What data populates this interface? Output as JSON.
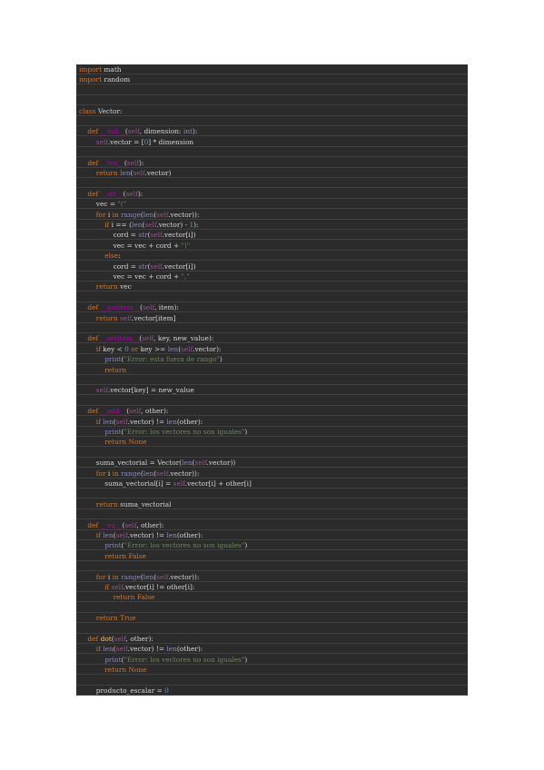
{
  "colors": {
    "page_background": "#ffffff",
    "editor_background": "#2b2b2b",
    "keyword": "#cc7832",
    "self": "#94558d",
    "function_name": "#ffc66d",
    "dunder": "#b200b2",
    "string": "#6a8759",
    "number": "#6897bb",
    "builtin": "#8888c6",
    "text": "#d4d4d4"
  },
  "code": {
    "lines": [
      {
        "tokens": [
          {
            "t": "import",
            "c": "kw"
          },
          {
            "t": " math",
            "c": "plain"
          }
        ]
      },
      {
        "tokens": [
          {
            "t": "import",
            "c": "kw"
          },
          {
            "t": " random",
            "c": "plain"
          }
        ]
      },
      {
        "tokens": []
      },
      {
        "tokens": []
      },
      {
        "tokens": [
          {
            "t": "class",
            "c": "kw"
          },
          {
            "t": " Vector:",
            "c": "plain"
          }
        ]
      },
      {
        "tokens": []
      },
      {
        "tokens": [
          {
            "t": "    def ",
            "c": "kw"
          },
          {
            "t": "__init__",
            "c": "dunder"
          },
          {
            "t": "(",
            "c": "plain"
          },
          {
            "t": "self",
            "c": "self"
          },
          {
            "t": ", dimension: ",
            "c": "plain"
          },
          {
            "t": "int",
            "c": "bi"
          },
          {
            "t": "):",
            "c": "plain"
          }
        ]
      },
      {
        "tokens": [
          {
            "t": "        ",
            "c": "plain"
          },
          {
            "t": "self",
            "c": "self"
          },
          {
            "t": ".vector = [",
            "c": "plain"
          },
          {
            "t": "0",
            "c": "num"
          },
          {
            "t": "] * dimension",
            "c": "plain"
          }
        ]
      },
      {
        "tokens": []
      },
      {
        "tokens": [
          {
            "t": "    def ",
            "c": "kw"
          },
          {
            "t": "__len__",
            "c": "dunder"
          },
          {
            "t": "(",
            "c": "plain"
          },
          {
            "t": "self",
            "c": "self"
          },
          {
            "t": "):",
            "c": "plain"
          }
        ]
      },
      {
        "tokens": [
          {
            "t": "        return ",
            "c": "kw"
          },
          {
            "t": "len",
            "c": "bi"
          },
          {
            "t": "(",
            "c": "plain"
          },
          {
            "t": "self",
            "c": "self"
          },
          {
            "t": ".vector)",
            "c": "plain"
          }
        ]
      },
      {
        "tokens": []
      },
      {
        "tokens": [
          {
            "t": "    def ",
            "c": "kw"
          },
          {
            "t": "__str__",
            "c": "dunder"
          },
          {
            "t": "(",
            "c": "plain"
          },
          {
            "t": "self",
            "c": "self"
          },
          {
            "t": "):",
            "c": "plain"
          }
        ]
      },
      {
        "tokens": [
          {
            "t": "        vec = ",
            "c": "plain"
          },
          {
            "t": "\"(\"",
            "c": "str"
          }
        ]
      },
      {
        "tokens": [
          {
            "t": "        for ",
            "c": "kw"
          },
          {
            "t": "i ",
            "c": "plain"
          },
          {
            "t": "in ",
            "c": "kw"
          },
          {
            "t": "range",
            "c": "bi"
          },
          {
            "t": "(",
            "c": "plain"
          },
          {
            "t": "len",
            "c": "bi"
          },
          {
            "t": "(",
            "c": "plain"
          },
          {
            "t": "self",
            "c": "self"
          },
          {
            "t": ".vector)):",
            "c": "plain"
          }
        ]
      },
      {
        "tokens": [
          {
            "t": "            if ",
            "c": "kw"
          },
          {
            "t": "i == (",
            "c": "plain"
          },
          {
            "t": "len",
            "c": "bi"
          },
          {
            "t": "(",
            "c": "plain"
          },
          {
            "t": "self",
            "c": "self"
          },
          {
            "t": ".vector) - ",
            "c": "plain"
          },
          {
            "t": "1",
            "c": "num"
          },
          {
            "t": "):",
            "c": "plain"
          }
        ]
      },
      {
        "tokens": [
          {
            "t": "                cord = ",
            "c": "plain"
          },
          {
            "t": "str",
            "c": "bi"
          },
          {
            "t": "(",
            "c": "plain"
          },
          {
            "t": "self",
            "c": "self"
          },
          {
            "t": ".vector[i])",
            "c": "plain"
          }
        ]
      },
      {
        "tokens": [
          {
            "t": "                vec = vec + cord + ",
            "c": "plain"
          },
          {
            "t": "\")\"",
            "c": "str"
          }
        ]
      },
      {
        "tokens": [
          {
            "t": "            else",
            "c": "kw"
          },
          {
            "t": ":",
            "c": "plain"
          }
        ]
      },
      {
        "tokens": [
          {
            "t": "                cord = ",
            "c": "plain"
          },
          {
            "t": "str",
            "c": "bi"
          },
          {
            "t": "(",
            "c": "plain"
          },
          {
            "t": "self",
            "c": "self"
          },
          {
            "t": ".vector[i])",
            "c": "plain"
          }
        ]
      },
      {
        "tokens": [
          {
            "t": "                vec = vec + cord + ",
            "c": "plain"
          },
          {
            "t": "\",\"",
            "c": "str"
          }
        ]
      },
      {
        "tokens": [
          {
            "t": "        return ",
            "c": "kw"
          },
          {
            "t": "vec",
            "c": "plain"
          }
        ]
      },
      {
        "tokens": []
      },
      {
        "tokens": [
          {
            "t": "    def ",
            "c": "kw"
          },
          {
            "t": "__getitem__",
            "c": "dunder"
          },
          {
            "t": "(",
            "c": "plain"
          },
          {
            "t": "self",
            "c": "self"
          },
          {
            "t": ", item):",
            "c": "plain"
          }
        ]
      },
      {
        "tokens": [
          {
            "t": "        return ",
            "c": "kw"
          },
          {
            "t": "self",
            "c": "self"
          },
          {
            "t": ".vector[item]",
            "c": "plain"
          }
        ]
      },
      {
        "tokens": []
      },
      {
        "tokens": [
          {
            "t": "    def ",
            "c": "kw"
          },
          {
            "t": "__setitem__",
            "c": "dunder"
          },
          {
            "t": "(",
            "c": "plain"
          },
          {
            "t": "self",
            "c": "self"
          },
          {
            "t": ", key, new_value):",
            "c": "plain"
          }
        ]
      },
      {
        "tokens": [
          {
            "t": "        if ",
            "c": "kw"
          },
          {
            "t": "key < ",
            "c": "plain"
          },
          {
            "t": "0",
            "c": "num"
          },
          {
            "t": " or ",
            "c": "kw"
          },
          {
            "t": "key >= ",
            "c": "plain"
          },
          {
            "t": "len",
            "c": "bi"
          },
          {
            "t": "(",
            "c": "plain"
          },
          {
            "t": "self",
            "c": "self"
          },
          {
            "t": ".vector):",
            "c": "plain"
          }
        ]
      },
      {
        "tokens": [
          {
            "t": "            ",
            "c": "plain"
          },
          {
            "t": "print",
            "c": "bi"
          },
          {
            "t": "(",
            "c": "plain"
          },
          {
            "t": "\"Error: esta fuera de rango\"",
            "c": "str"
          },
          {
            "t": ")",
            "c": "plain"
          }
        ]
      },
      {
        "tokens": [
          {
            "t": "            return",
            "c": "kw"
          }
        ]
      },
      {
        "tokens": []
      },
      {
        "tokens": [
          {
            "t": "        ",
            "c": "plain"
          },
          {
            "t": "self",
            "c": "self"
          },
          {
            "t": ".vector[key] = new_value",
            "c": "plain"
          }
        ]
      },
      {
        "tokens": []
      },
      {
        "tokens": [
          {
            "t": "    def ",
            "c": "kw"
          },
          {
            "t": "__add__",
            "c": "dunder"
          },
          {
            "t": "(",
            "c": "plain"
          },
          {
            "t": "self",
            "c": "self"
          },
          {
            "t": ", other):",
            "c": "plain"
          }
        ]
      },
      {
        "tokens": [
          {
            "t": "        if ",
            "c": "kw"
          },
          {
            "t": "len",
            "c": "bi"
          },
          {
            "t": "(",
            "c": "plain"
          },
          {
            "t": "self",
            "c": "self"
          },
          {
            "t": ".vector) != ",
            "c": "plain"
          },
          {
            "t": "len",
            "c": "bi"
          },
          {
            "t": "(other):",
            "c": "plain"
          }
        ]
      },
      {
        "tokens": [
          {
            "t": "            ",
            "c": "plain"
          },
          {
            "t": "print",
            "c": "bi"
          },
          {
            "t": "(",
            "c": "plain"
          },
          {
            "t": "\"Error: los vectores no son iguales\"",
            "c": "str"
          },
          {
            "t": ")",
            "c": "plain"
          }
        ]
      },
      {
        "tokens": [
          {
            "t": "            return None",
            "c": "kw"
          }
        ]
      },
      {
        "tokens": []
      },
      {
        "tokens": [
          {
            "t": "        suma_vectorial = Vector(",
            "c": "plain"
          },
          {
            "t": "len",
            "c": "bi"
          },
          {
            "t": "(",
            "c": "plain"
          },
          {
            "t": "self",
            "c": "self"
          },
          {
            "t": ".vector))",
            "c": "plain"
          }
        ]
      },
      {
        "tokens": [
          {
            "t": "        for ",
            "c": "kw"
          },
          {
            "t": "i ",
            "c": "plain"
          },
          {
            "t": "in ",
            "c": "kw"
          },
          {
            "t": "range",
            "c": "bi"
          },
          {
            "t": "(",
            "c": "plain"
          },
          {
            "t": "len",
            "c": "bi"
          },
          {
            "t": "(",
            "c": "plain"
          },
          {
            "t": "self",
            "c": "self"
          },
          {
            "t": ".vector)):",
            "c": "plain"
          }
        ]
      },
      {
        "tokens": [
          {
            "t": "            suma_vectorial[i] = ",
            "c": "plain"
          },
          {
            "t": "self",
            "c": "self"
          },
          {
            "t": ".vector[i] + other[i]",
            "c": "plain"
          }
        ]
      },
      {
        "tokens": []
      },
      {
        "tokens": [
          {
            "t": "        return ",
            "c": "kw"
          },
          {
            "t": "suma_vectorial",
            "c": "plain"
          }
        ]
      },
      {
        "tokens": []
      },
      {
        "tokens": [
          {
            "t": "    def ",
            "c": "kw"
          },
          {
            "t": "__eq__",
            "c": "dunder"
          },
          {
            "t": "(",
            "c": "plain"
          },
          {
            "t": "self",
            "c": "self"
          },
          {
            "t": ", other):",
            "c": "plain"
          }
        ]
      },
      {
        "tokens": [
          {
            "t": "        if ",
            "c": "kw"
          },
          {
            "t": "len",
            "c": "bi"
          },
          {
            "t": "(",
            "c": "plain"
          },
          {
            "t": "self",
            "c": "self"
          },
          {
            "t": ".vector) != ",
            "c": "plain"
          },
          {
            "t": "len",
            "c": "bi"
          },
          {
            "t": "(other):",
            "c": "plain"
          }
        ]
      },
      {
        "tokens": [
          {
            "t": "            ",
            "c": "plain"
          },
          {
            "t": "print",
            "c": "bi"
          },
          {
            "t": "(",
            "c": "plain"
          },
          {
            "t": "\"Error: los vectores no son iguales\"",
            "c": "str"
          },
          {
            "t": ")",
            "c": "plain"
          }
        ]
      },
      {
        "tokens": [
          {
            "t": "            return False",
            "c": "kw"
          }
        ]
      },
      {
        "tokens": []
      },
      {
        "tokens": [
          {
            "t": "        for ",
            "c": "kw"
          },
          {
            "t": "i ",
            "c": "plain"
          },
          {
            "t": "in ",
            "c": "kw"
          },
          {
            "t": "range",
            "c": "bi"
          },
          {
            "t": "(",
            "c": "plain"
          },
          {
            "t": "len",
            "c": "bi"
          },
          {
            "t": "(",
            "c": "plain"
          },
          {
            "t": "self",
            "c": "self"
          },
          {
            "t": ".vector)):",
            "c": "plain"
          }
        ]
      },
      {
        "tokens": [
          {
            "t": "            if ",
            "c": "kw"
          },
          {
            "t": "self",
            "c": "self"
          },
          {
            "t": ".vector[i] != other[i]:",
            "c": "plain"
          }
        ]
      },
      {
        "tokens": [
          {
            "t": "                return False",
            "c": "kw"
          }
        ]
      },
      {
        "tokens": []
      },
      {
        "tokens": [
          {
            "t": "        return True",
            "c": "kw"
          }
        ]
      },
      {
        "tokens": []
      },
      {
        "tokens": [
          {
            "t": "    def ",
            "c": "kw"
          },
          {
            "t": "dot",
            "c": "fn"
          },
          {
            "t": "(",
            "c": "plain"
          },
          {
            "t": "self",
            "c": "self"
          },
          {
            "t": ", other):",
            "c": "plain"
          }
        ]
      },
      {
        "tokens": [
          {
            "t": "        if ",
            "c": "kw"
          },
          {
            "t": "len",
            "c": "bi"
          },
          {
            "t": "(",
            "c": "plain"
          },
          {
            "t": "self",
            "c": "self"
          },
          {
            "t": ".vector) != ",
            "c": "plain"
          },
          {
            "t": "len",
            "c": "bi"
          },
          {
            "t": "(other):",
            "c": "plain"
          }
        ]
      },
      {
        "tokens": [
          {
            "t": "            ",
            "c": "plain"
          },
          {
            "t": "print",
            "c": "bi"
          },
          {
            "t": "(",
            "c": "plain"
          },
          {
            "t": "\"Error: los vectores no son iguales\"",
            "c": "str"
          },
          {
            "t": ")",
            "c": "plain"
          }
        ]
      },
      {
        "tokens": [
          {
            "t": "            return None",
            "c": "kw"
          }
        ]
      },
      {
        "tokens": []
      },
      {
        "tokens": [
          {
            "t": "        producto_escalar = ",
            "c": "plain"
          },
          {
            "t": "0",
            "c": "num"
          }
        ]
      }
    ]
  }
}
